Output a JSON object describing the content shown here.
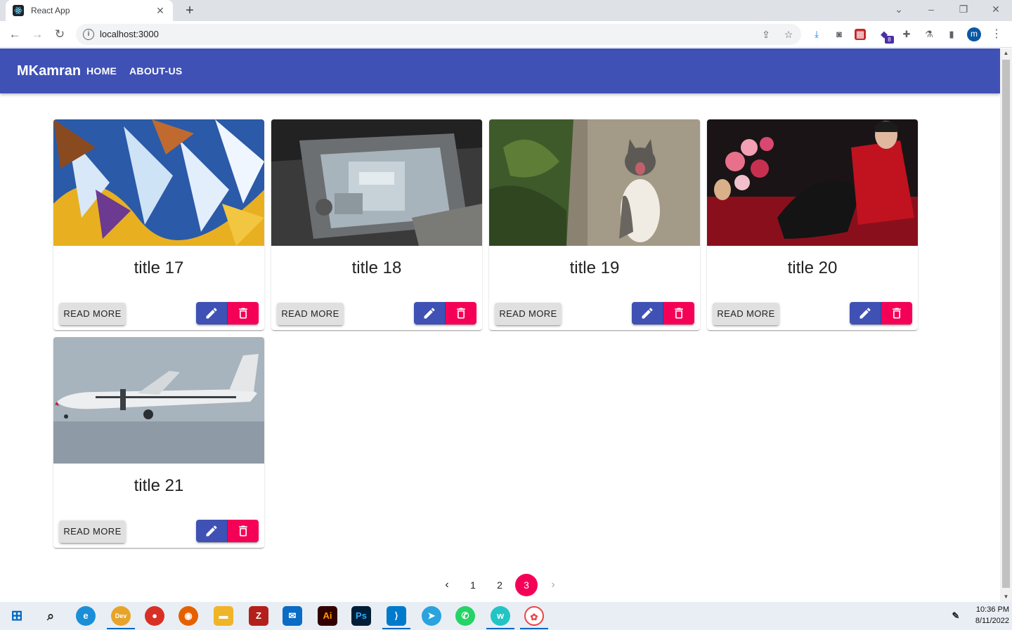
{
  "browser": {
    "tab_title": "React App",
    "tab_close": "✕",
    "new_tab": "+",
    "url": "localhost:3000",
    "profile_initial": "m",
    "extension_badge": "8"
  },
  "app": {
    "brand": "MKamran",
    "nav": [
      {
        "label": "HOME"
      },
      {
        "label": "ABOUT-US"
      }
    ]
  },
  "cards": [
    {
      "title": "title 17",
      "read_more": "READ MORE",
      "image": "crystal-macro-image"
    },
    {
      "title": "title 18",
      "read_more": "READ MORE",
      "image": "machinery-image"
    },
    {
      "title": "title 19",
      "read_more": "READ MORE",
      "image": "cat-image"
    },
    {
      "title": "title 20",
      "read_more": "READ MORE",
      "image": "valentine-avatar-image"
    },
    {
      "title": "title 21",
      "read_more": "READ MORE",
      "image": "airplane-image"
    }
  ],
  "pagination": {
    "prev": "‹",
    "pages": [
      "1",
      "2",
      "3"
    ],
    "current": "3",
    "next": "›"
  },
  "taskbar": {
    "time": "10:36 PM",
    "date": "8/11/2022"
  },
  "colors": {
    "primary": "#3f51b5",
    "secondary": "#f50057",
    "button_grey": "#e0e0e0"
  }
}
